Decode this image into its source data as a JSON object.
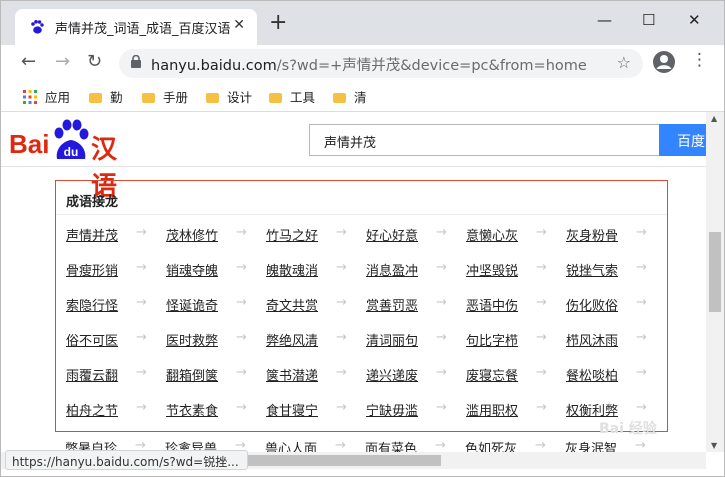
{
  "browser": {
    "tab_title": "声情并茂_词语_成语_百度汉语",
    "tab_close": "✕",
    "new_tab": "+",
    "window_buttons": {
      "minimize": "—",
      "maximize": "☐",
      "close": "✕"
    },
    "url_host": "hanyu.baidu.com",
    "url_path": "/s?wd=+声情并茂&device=pc&from=home",
    "bookmarks": [
      {
        "label": "应用",
        "icon": "apps-grid-icon"
      },
      {
        "label": "勤",
        "icon": "folder-icon"
      },
      {
        "label": "手册",
        "icon": "folder-icon"
      },
      {
        "label": "设计",
        "icon": "folder-icon"
      },
      {
        "label": "工具",
        "icon": "folder-icon"
      },
      {
        "label": "清",
        "icon": "folder-icon"
      }
    ],
    "status_url": "https://hanyu.baidu.com/s?wd=锐挫...",
    "colors": {
      "tabstrip": "#dee1e6",
      "search_button": "#3385ff",
      "panel_border": "#d94a38",
      "logo_red": "#de2910",
      "logo_blue": "#2319dc"
    }
  },
  "page": {
    "logo_prefix": "Bai",
    "logo_du": "du",
    "logo_suffix": "汉语",
    "search_query": "声情并茂",
    "search_button": "百度",
    "panel_title": "成语接龙",
    "arrow": "→",
    "idiom_rows": [
      [
        "声情并茂",
        "茂林修竹",
        "竹马之好",
        "好心好意",
        "意懒心灰",
        "灰身粉骨"
      ],
      [
        "骨瘦形销",
        "销魂夺魄",
        "魄散魂消",
        "消息盈冲",
        "冲坚毁锐",
        "锐挫气索"
      ],
      [
        "索隐行怪",
        "怪诞诡奇",
        "奇文共赏",
        "赏善罚恶",
        "恶语中伤",
        "伤化败俗"
      ],
      [
        "俗不可医",
        "医时救弊",
        "弊绝风清",
        "清词丽句",
        "句比字栉",
        "栉风沐雨"
      ],
      [
        "雨覆云翻",
        "翻箱倒箧",
        "箧书潜递",
        "递兴递废",
        "废寝忘餐",
        "餐松啖柏"
      ],
      [
        "柏舟之节",
        "节衣素食",
        "食甘寝宁",
        "宁缺毋滥",
        "滥用职权",
        "权衡利弊"
      ]
    ],
    "idiom_row_partial": [
      "弊暑自珍",
      "珍禽异兽",
      "兽心人面",
      "面有菜色",
      "色如死灰",
      "灰身泯智"
    ],
    "watermark": "Bai 经验"
  }
}
